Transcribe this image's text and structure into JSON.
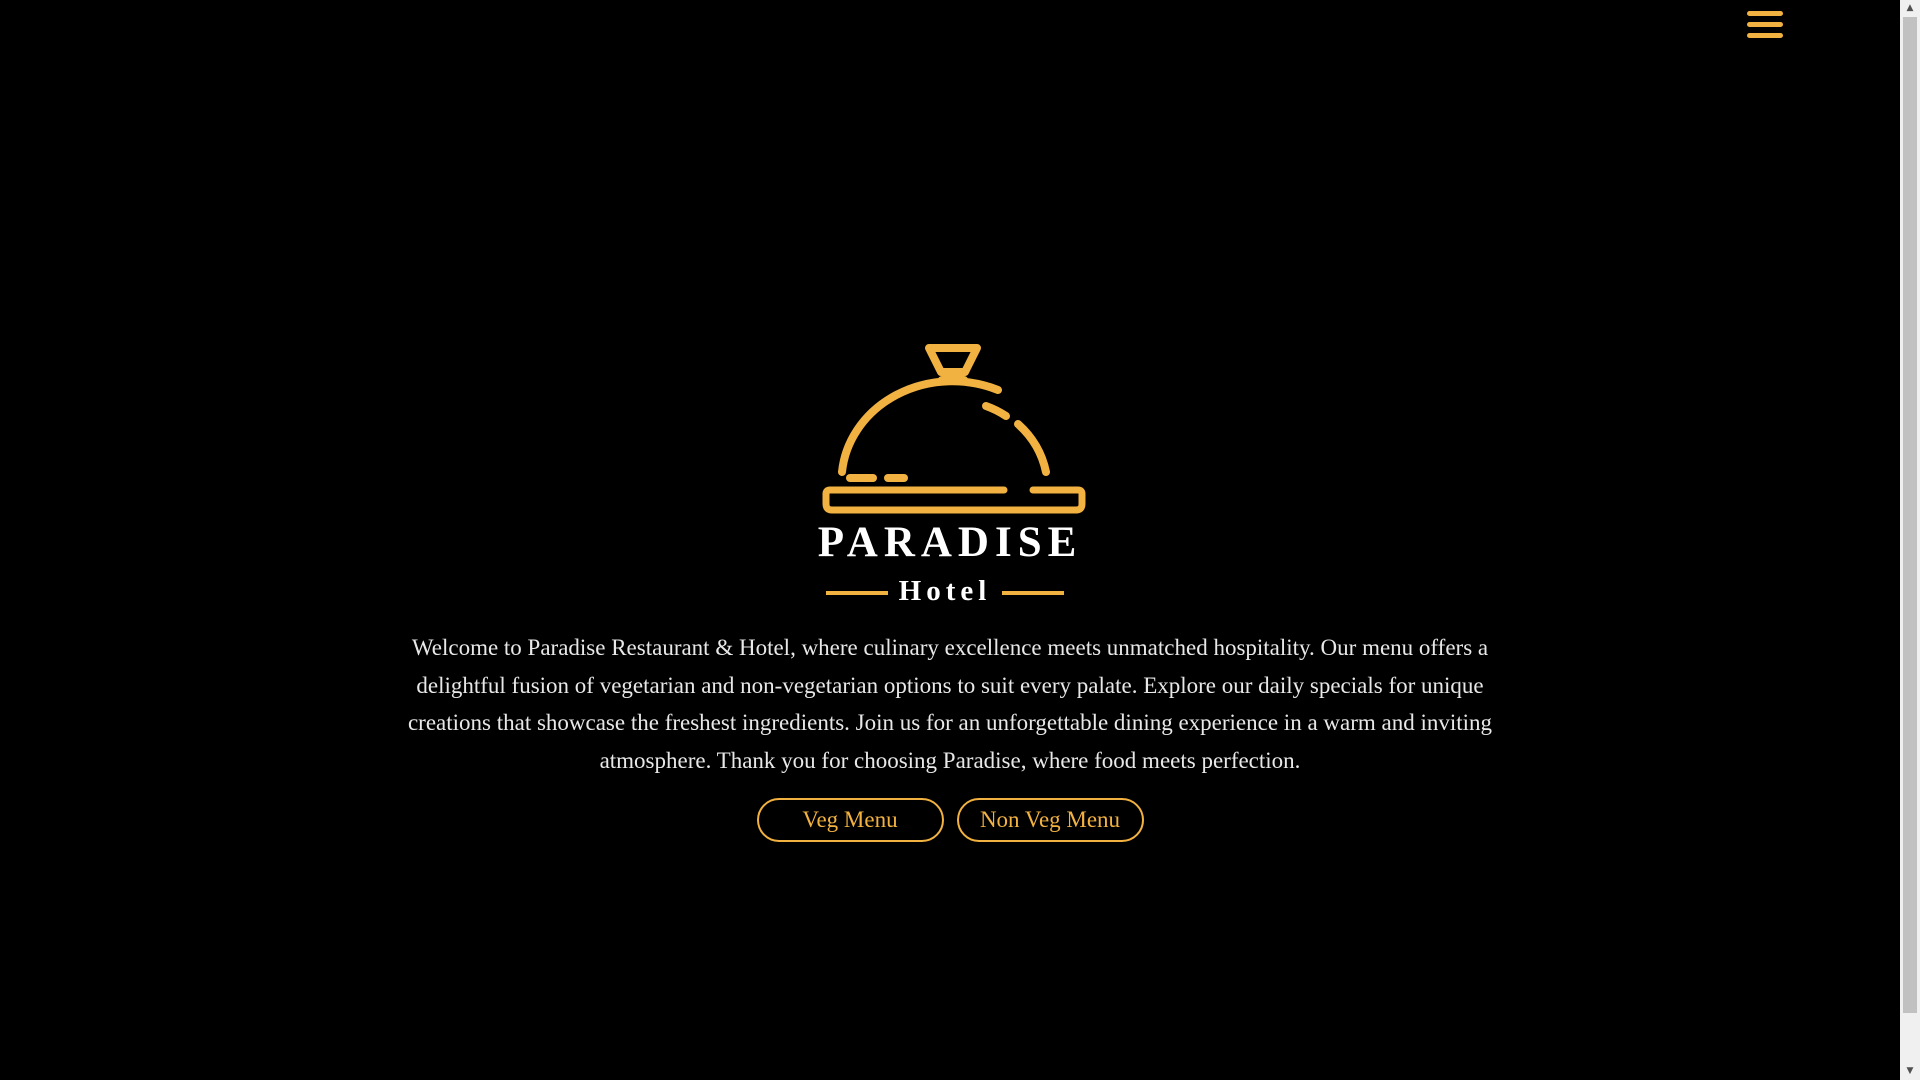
{
  "nav": {
    "menu_icon": "hamburger-menu-icon"
  },
  "logo": {
    "icon": "cloche-dish-icon",
    "name": "PARADISE",
    "subtitle": "Hotel"
  },
  "welcome": {
    "text": "Welcome to Paradise Restaurant & Hotel, where culinary excellence meets unmatched hospitality. Our menu offers a delightful fusion of vegetarian and non-vegetarian options to suit every palate. Explore our daily specials for unique creations that showcase the freshest ingredients. Join us for an unforgettable dining experience in a warm and inviting atmosphere. Thank you for choosing Paradise, where food meets perfection."
  },
  "buttons": {
    "veg_label": "Veg Menu",
    "nonveg_label": "Non Veg Menu"
  },
  "colors": {
    "accent": "#f2b241",
    "background": "#000000",
    "text": "#e8e8e8",
    "brand_text": "#ffffff"
  },
  "scrollbar": {
    "up_arrow": "▲",
    "down_arrow": "▼"
  }
}
